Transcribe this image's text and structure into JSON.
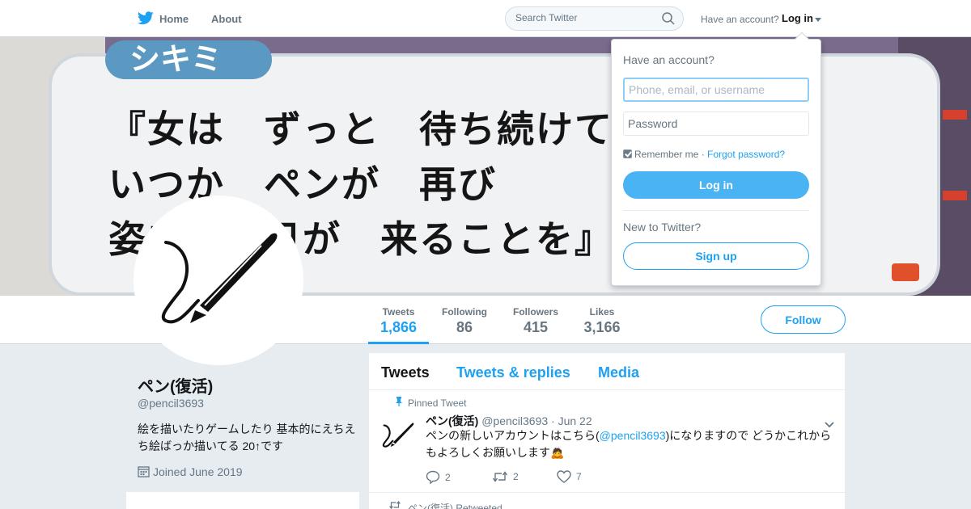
{
  "nav": {
    "home_label": "Home",
    "about_label": "About",
    "search_placeholder": "Search Twitter",
    "account_question": "Have an account?",
    "login_label": "Log in"
  },
  "banner": {
    "tag": "シキミ",
    "lines": [
      "『女は　ずっと　待ち続けてい",
      "いつか　ペンが　再び",
      "姿を　　日が　来ることを』"
    ]
  },
  "profile": {
    "name": "ペン(復活)",
    "handle": "@pencil3693",
    "bio": "絵を描いたりゲームしたり 基本的にえちえち絵ばっか描いてる 20↑です",
    "joined": "Joined June 2019",
    "follow_label": "Follow"
  },
  "stats": [
    {
      "label": "Tweets",
      "value": "1,866"
    },
    {
      "label": "Following",
      "value": "86"
    },
    {
      "label": "Followers",
      "value": "415"
    },
    {
      "label": "Likes",
      "value": "3,166"
    }
  ],
  "timeline": {
    "tabs": [
      "Tweets",
      "Tweets & replies",
      "Media"
    ],
    "pinned_label": "Pinned Tweet",
    "tweet": {
      "name": "ペン(復活)",
      "handle": "@pencil3693",
      "date": "· Jun 22",
      "text_before": "ペンの新しいアカウントはこちら(",
      "mention": "@pencil3693",
      "text_after": ")になりますので どうかこれからもよろしくお願いします🙇",
      "replies": "2",
      "retweets": "2",
      "likes": "7"
    },
    "retweeted_label": "ペン(復活) Retweeted"
  },
  "login_dropdown": {
    "title": "Have an account?",
    "username_placeholder": "Phone, email, or username",
    "password_placeholder": "Password",
    "remember_label": "Remember me",
    "separator": "·",
    "forgot_label": "Forgot password?",
    "login_button": "Log in",
    "new_label": "New to Twitter?",
    "signup_button": "Sign up"
  },
  "colors": {
    "accent": "#1da1f2",
    "page_background": "#e6ecf0"
  }
}
